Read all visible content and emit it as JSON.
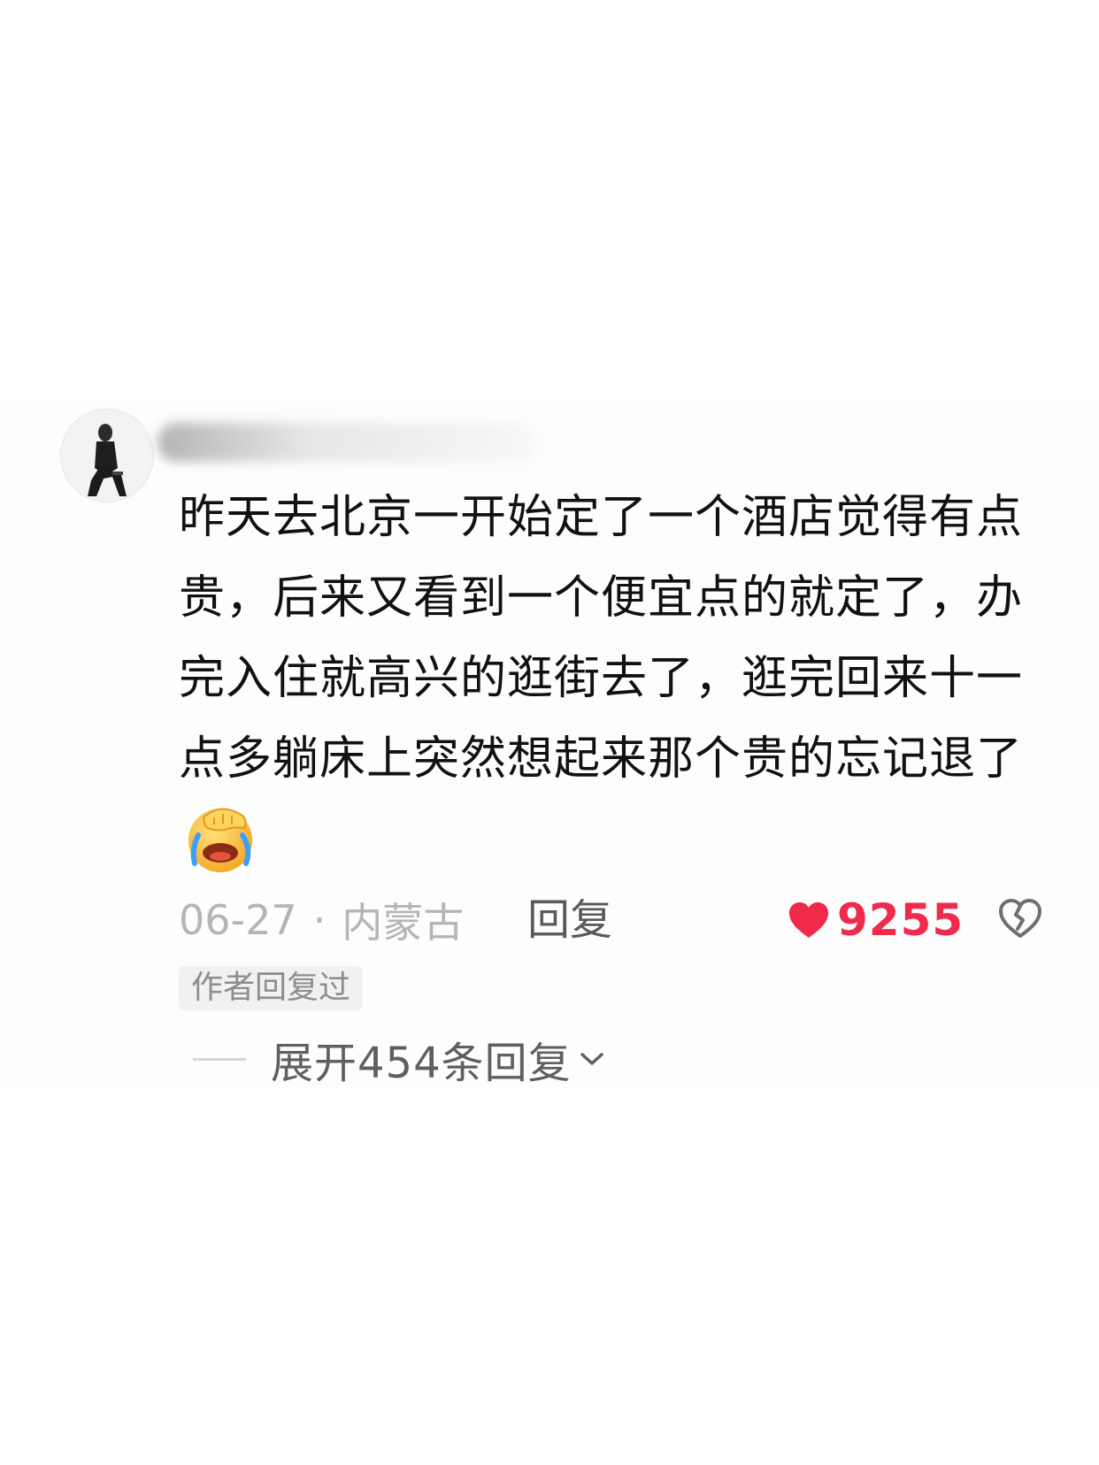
{
  "comment": {
    "avatar_icon": "avatar-photo",
    "username": "",
    "text": "昨天去北京一开始定了一个酒店觉得有点贵，后来又看到一个便宜点的就定了，办完入住就高兴的逛街去了，逛完回来十一点多躺床上突然想起来那个贵的忘记退了",
    "emoji_icon": "facepalm-laughing-crying-emoji",
    "date": "06-27",
    "separator": "·",
    "location": "内蒙古",
    "reply_label": "回复",
    "like_icon": "heart-icon",
    "like_count": "9255",
    "dislike_icon": "broken-heart-icon",
    "author_badge": "作者回复过",
    "expand_label": "展开454条回复",
    "expand_icon": "chevron-down-icon"
  },
  "colors": {
    "like": "#ef2a4a",
    "meta": "#b5b5b5",
    "text": "#111111"
  }
}
